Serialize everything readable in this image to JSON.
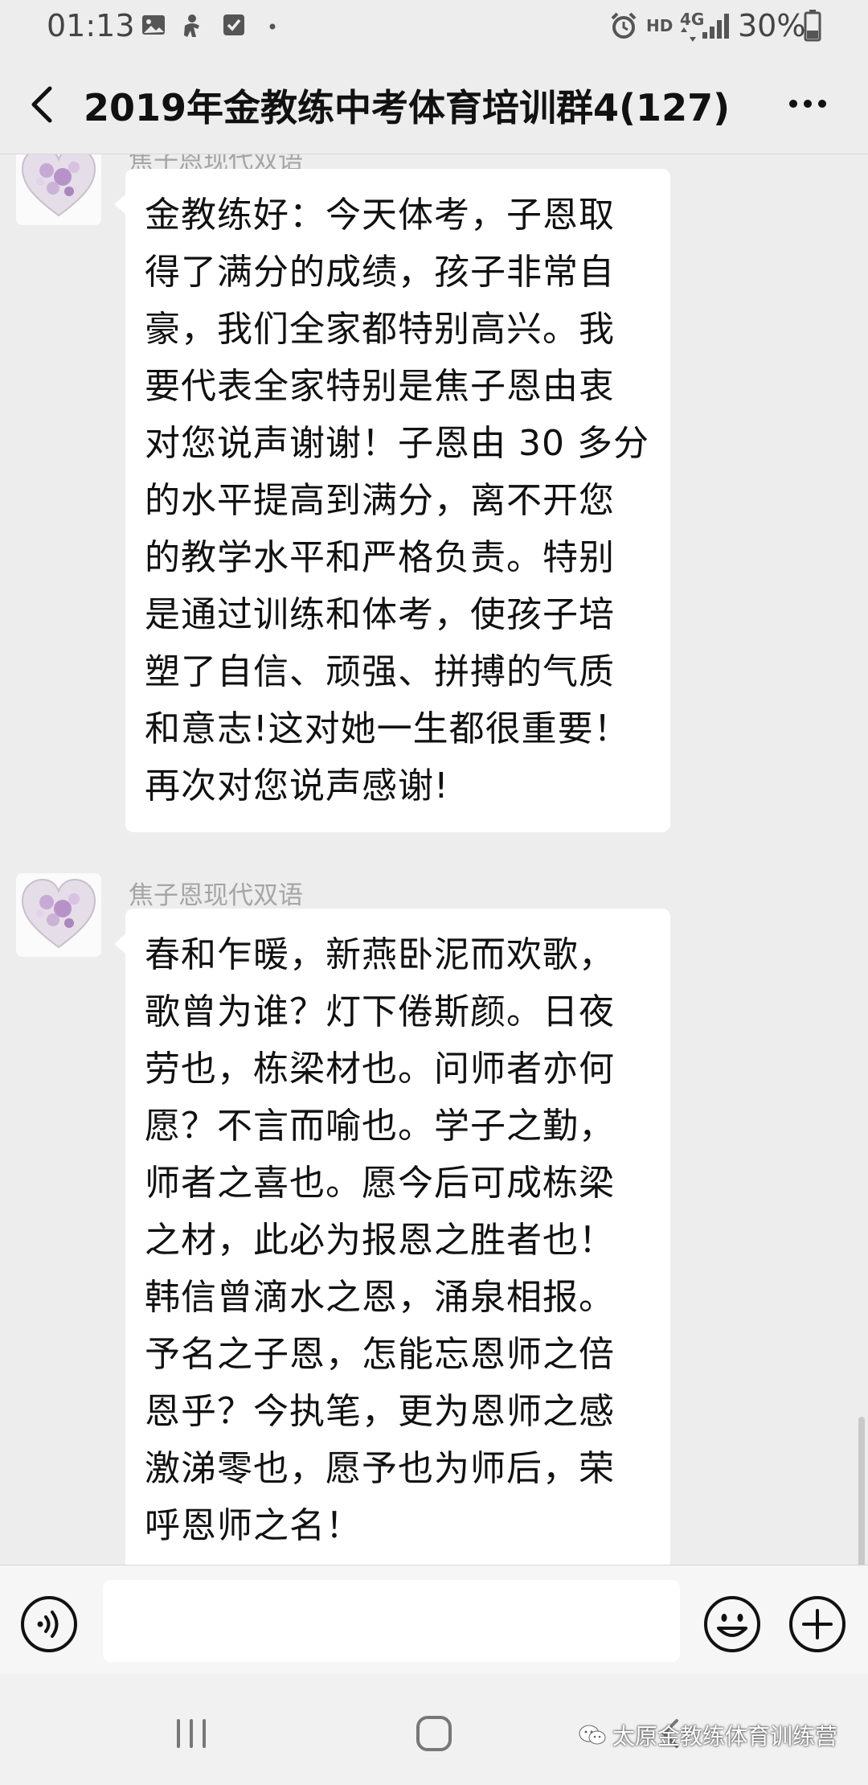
{
  "status_bar": {
    "time": "01:13",
    "network_hd": "HD",
    "network_type": "4G",
    "battery": "30%"
  },
  "header": {
    "title": "2019年金教练中考体育培训群4(127)"
  },
  "messages": [
    {
      "sender": "焦子恩现代双语",
      "text": "金教练好：今天体考，子恩取\n得了满分的成绩，孩子非常自\n豪，我们全家都特别高兴。我\n要代表全家特别是焦子恩由衷\n对您说声谢谢！子恩由 30 多分\n的水平提高到满分，离不开您\n的教学水平和严格负责。特别\n是通过训练和体考，使孩子培\n塑了自信、顽强、拼搏的气质\n和意志!这对她一生都很重要！\n再次对您说声感谢!"
    },
    {
      "sender": "焦子恩现代双语",
      "text": "春和乍暖，新燕卧泥而欢歌，\n歌曾为谁？灯下倦斯颜。日夜\n劳也，栋梁材也。问师者亦何\n愿？不言而喻也。学子之勤，\n师者之喜也。愿今后可成栋梁\n之材，此必为报恩之胜者也！\n韩信曾滴水之恩，涌泉相报。\n予名之子恩，怎能忘恩师之倍\n恩乎？今执笔，更为恩师之感\n激涕零也，愿予也为师后，荣\n呼恩师之名！"
    }
  ],
  "input": {
    "placeholder": ""
  },
  "watermark": "太原金教练体育训练营",
  "icons": {
    "back": "chevron-left-icon",
    "more": "more-dots-icon",
    "voice": "voice-icon",
    "emoji": "emoji-icon",
    "add": "plus-circle-icon"
  }
}
